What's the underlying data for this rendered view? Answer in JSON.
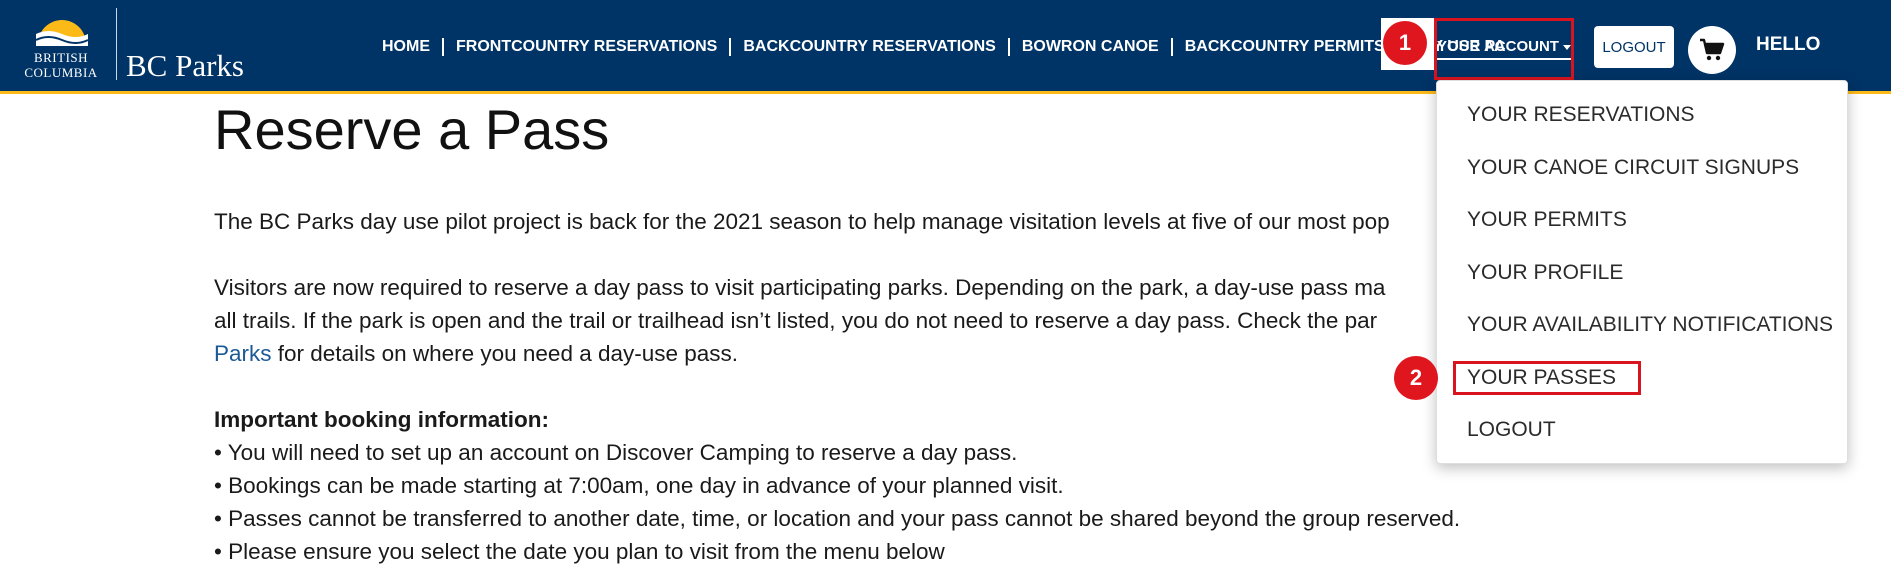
{
  "header": {
    "logo": {
      "gov_line1": "BRITISH",
      "gov_line2": "COLUMBIA",
      "brand": "BC Parks"
    },
    "nav": [
      {
        "label": "HOME"
      },
      {
        "label": "FRONTCOUNTRY RESERVATIONS"
      },
      {
        "label": "BACKCOUNTRY RESERVATIONS"
      },
      {
        "label": "BOWRON CANOE"
      },
      {
        "label": "BACKCOUNTRY PERMITS"
      },
      {
        "label": "DAY USE PA"
      }
    ],
    "account_label": "YOUR ACCOUNT",
    "logout_label": "LOGOUT",
    "greeting": "HELLO",
    "cart_icon": "cart-icon"
  },
  "markers": {
    "step1": "1",
    "step2": "2"
  },
  "account_menu": {
    "items": [
      {
        "label": "YOUR RESERVATIONS"
      },
      {
        "label": "YOUR CANOE CIRCUIT SIGNUPS"
      },
      {
        "label": "YOUR PERMITS"
      },
      {
        "label": "YOUR PROFILE"
      },
      {
        "label": "YOUR AVAILABILITY NOTIFICATIONS"
      },
      {
        "label": "YOUR PASSES"
      },
      {
        "label": "LOGOUT"
      }
    ]
  },
  "main": {
    "title": "Reserve a Pass",
    "intro": "The BC Parks day use pilot project is back for the 2021 season to help manage visitation levels at five of our most pop",
    "visitors_line1": "Visitors are now required to reserve a day pass to visit participating parks. Depending on the park, a day-use pass ma",
    "visitors_line2": "all trails. If the park is open and the trail or trailhead isn’t listed, you do not need to reserve a day pass. Check the par",
    "visitors_link": "Parks",
    "visitors_line3_rest": " for details on where you need a day-use pass.",
    "important_heading": "Important booking information:",
    "bullets": [
      "• You will need to set up an account on Discover Camping to reserve a day pass.",
      "• Bookings can be made starting at 7:00am, one day in advance of your planned visit.",
      "• Passes cannot be transferred to another date, time, or location and your pass cannot be shared beyond the group reserved.",
      "• Please ensure you select the date you plan to visit from the menu below"
    ]
  },
  "colors": {
    "header_bg": "#003366",
    "accent_gold": "#fcba19",
    "highlight_red": "#d9141e",
    "link": "#1a5a96"
  }
}
